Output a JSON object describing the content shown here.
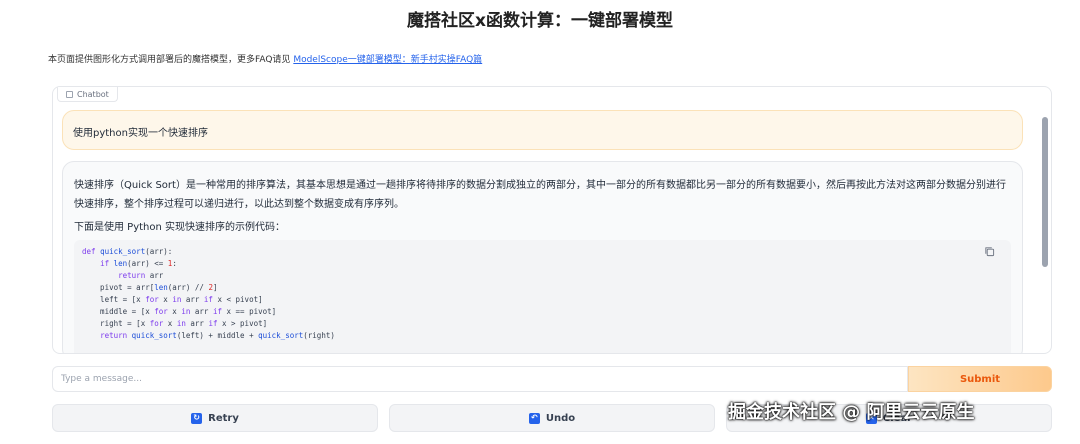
{
  "header": {
    "title": "魔搭社区x函数计算：一键部署模型"
  },
  "intro": {
    "text": "本页面提供图形化方式调用部署后的魔搭模型，更多FAQ请见",
    "link_text": "ModelScope一键部署模型：新手村实操FAQ篇"
  },
  "chatbot": {
    "label": "Chatbot",
    "user_message": "使用python实现一个快速排序",
    "bot_paragraph_1": "快速排序（Quick Sort）是一种常用的排序算法，其基本思想是通过一趟排序将待排序的数据分割成独立的两部分，其中一部分的所有数据都比另一部分的所有数据要小，然后再按此方法对这两部分数据分别进行快速排序，整个排序过程可以递归进行，以此达到整个数据变成有序序列。",
    "bot_paragraph_2": "下面是使用 Python 实现快速排序的示例代码：",
    "code_lines": [
      "def quick_sort(arr):",
      "    if len(arr) <= 1:",
      "        return arr",
      "    pivot = arr[len(arr) // 2]",
      "    left = [x for x in arr if x < pivot]",
      "    middle = [x for x in arr if x == pivot]",
      "    right = [x for x in arr if x > pivot]",
      "    return quick_sort(left) + middle + quick_sort(right)"
    ]
  },
  "input": {
    "placeholder": "Type a message...",
    "value": ""
  },
  "buttons": {
    "submit": "Submit",
    "retry": "Retry",
    "undo": "Undo",
    "clear": "Clear"
  },
  "icons": {
    "retry": "retry-icon",
    "undo": "undo-icon",
    "clear": "clear-icon",
    "copy": "copy-icon"
  },
  "watermark": "掘金技术社区 @ 阿里云云原生",
  "colors": {
    "accent": "#ea580c",
    "link": "#2563eb",
    "user_bubble": "#fef7ea",
    "button_icon": "#2563eb"
  }
}
